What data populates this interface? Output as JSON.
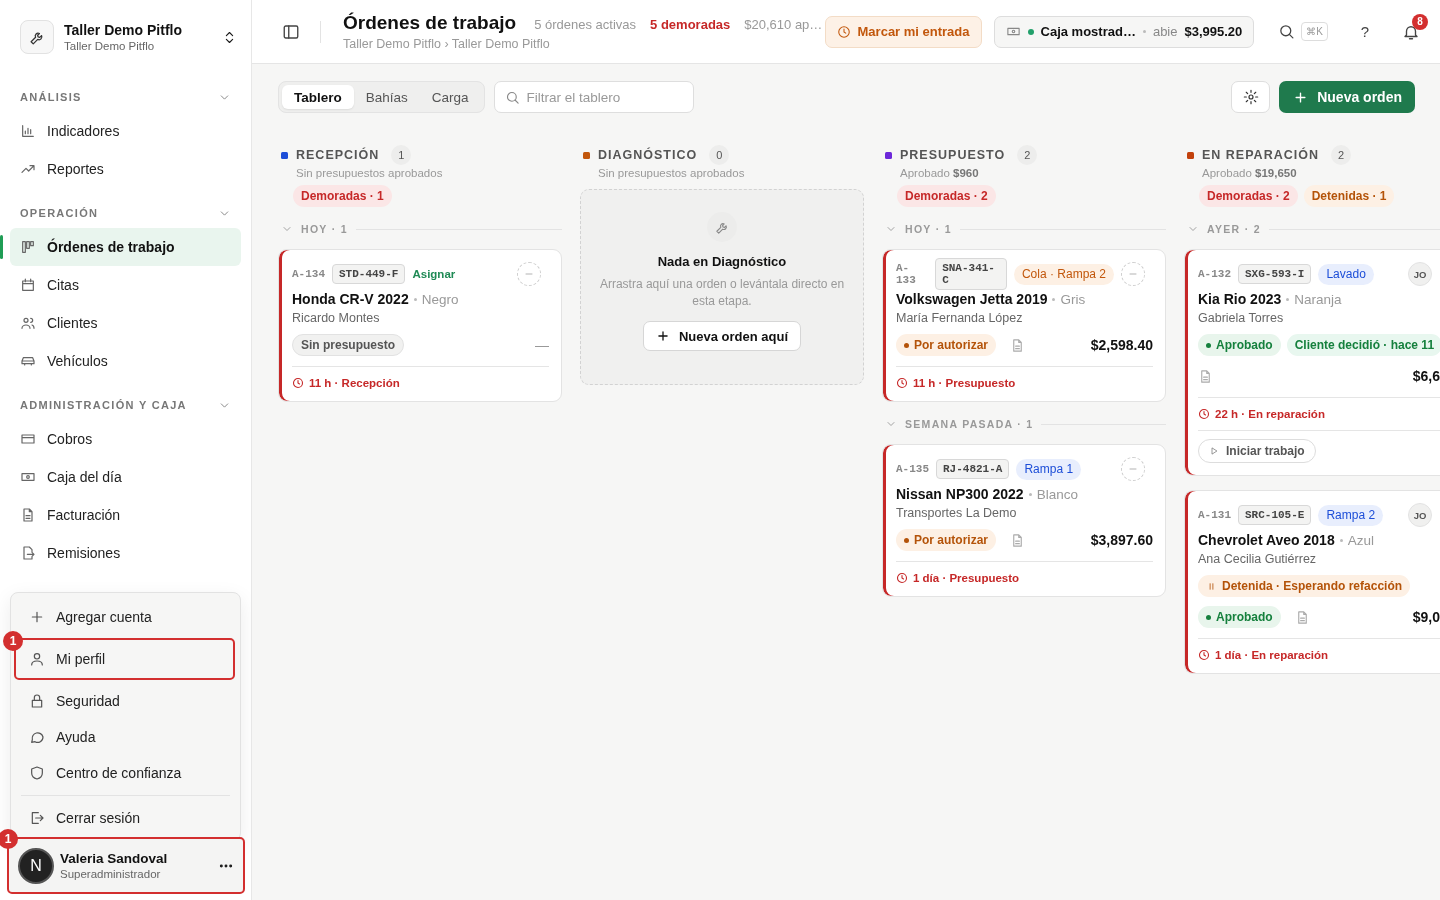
{
  "sidebar": {
    "workspace": {
      "name": "Taller Demo Pitflo",
      "subtitle": "Taller Demo Pitflo"
    },
    "sections": [
      {
        "title": "ANÁLISIS",
        "expanded": true,
        "items": [
          {
            "label": "Indicadores",
            "selected": false
          },
          {
            "label": "Reportes",
            "selected": false
          }
        ]
      },
      {
        "title": "OPERACIÓN",
        "expanded": true,
        "items": [
          {
            "label": "Órdenes de trabajo",
            "selected": true
          },
          {
            "label": "Citas",
            "selected": false
          },
          {
            "label": "Clientes",
            "selected": false
          },
          {
            "label": "Vehículos",
            "selected": false
          }
        ]
      },
      {
        "title": "ADMINISTRACIÓN Y CAJA",
        "expanded": true,
        "items": [
          {
            "label": "Cobros",
            "selected": false
          },
          {
            "label": "Caja del día",
            "selected": false
          },
          {
            "label": "Facturación",
            "selected": false
          },
          {
            "label": "Remisiones",
            "selected": false
          }
        ]
      }
    ],
    "account_menu": {
      "items": [
        {
          "label": "Agregar cuenta",
          "divider_before": false
        },
        {
          "label": "Mi perfil",
          "divider_before": false,
          "annotation": "1"
        },
        {
          "label": "Seguridad",
          "divider_before": false
        },
        {
          "label": "Ayuda",
          "divider_before": false
        },
        {
          "label": "Centro de confianza",
          "divider_before": false
        },
        {
          "label": "Cerrar sesión",
          "divider_before": true
        }
      ]
    },
    "user": {
      "initial": "N",
      "name": "Valeria Sandoval",
      "role": "Superadministrador",
      "annotation": "1"
    }
  },
  "header": {
    "title": "Órdenes de trabajo",
    "stats": [
      {
        "text": "5 órdenes activas",
        "kind": "normal"
      },
      {
        "text": "5 demoradas",
        "kind": "alert"
      },
      {
        "text": "$20,610 ap…",
        "kind": "normal"
      }
    ],
    "breadcrumb": "Taller Demo Pitflo › Taller Demo Pitflo",
    "clock_in": "Marcar mi entrada",
    "register": {
      "name": "Caja mostrad…",
      "open": true,
      "status": "abie",
      "amount": "$3,995.20"
    },
    "shortcut": "⌘K",
    "help": "?",
    "notifications": "8"
  },
  "toolbar": {
    "tabs": [
      {
        "label": "Tablero",
        "selected": true
      },
      {
        "label": "Bahías",
        "selected": false
      },
      {
        "label": "Carga",
        "selected": false
      }
    ],
    "filter": {
      "placeholder": "Filtrar el tablero"
    },
    "new_order": "Nueva orden"
  },
  "columns": [
    {
      "title": "RECEPCIÓN",
      "color": "#1d4ed8",
      "count": "1",
      "summary": "Sin presupuestos aprobados",
      "chips": [
        {
          "label": "Demoradas · 1",
          "kind": "delayed"
        }
      ],
      "groups": [
        {
          "label": "HOY · 1",
          "expanded": true,
          "cards": [
            {
              "id": "A-134",
              "plate": "STD-449-F",
              "tag": {
                "label": "Asignar",
                "kind": "assign"
              },
              "vehicle": "Honda CR-V 2022",
              "color_name": "Negro",
              "customer": "Ricardo Montes",
              "status": {
                "label": "Sin presupuesto",
                "kind": "neutral"
              },
              "document": false,
              "price": "—",
              "delayed": true,
              "timer": "11 h · Recepción"
            }
          ]
        }
      ]
    },
    {
      "title": "DIAGNÓSTICO",
      "color": "#c2570c",
      "count": "0",
      "summary": "Sin presupuestos aprobados",
      "empty": {
        "title": "Nada en Diagnóstico",
        "text": "Arrastra aquí una orden o levántala directo en esta etapa.",
        "button": "Nueva orden aquí"
      }
    },
    {
      "title": "PRESUPUESTO",
      "color": "#6d28d9",
      "count": "2",
      "summary": "Aprobado **$960**",
      "chips": [
        {
          "label": "Demoradas · 2",
          "kind": "delayed"
        }
      ],
      "groups": [
        {
          "label": "HOY · 1",
          "expanded": true,
          "cards": [
            {
              "id": "A-133",
              "plate": "SNA-341-C",
              "tag": {
                "label": "Cola · Rampa 2",
                "kind": "queue"
              },
              "vehicle": "Volkswagen Jetta 2019",
              "color_name": "Gris",
              "customer": "María Fernanda López",
              "status": {
                "label": "Por autorizar",
                "kind": "pending"
              },
              "document": true,
              "price": "$2,598.40",
              "delayed": true,
              "timer": "11 h · Presupuesto"
            }
          ]
        },
        {
          "label": "SEMANA PASADA · 1",
          "expanded": true,
          "cards": [
            {
              "id": "A-135",
              "plate": "RJ-4821-A",
              "tag": {
                "label": "Rampa 1",
                "kind": "bay"
              },
              "vehicle": "Nissan NP300 2022",
              "color_name": "Blanco",
              "customer": "Transportes La Demo",
              "status": {
                "label": "Por autorizar",
                "kind": "pending"
              },
              "document": true,
              "price": "$3,897.60",
              "delayed": true,
              "timer": "1 día · Presupuesto"
            }
          ]
        }
      ]
    },
    {
      "title": "EN REPARACIÓN",
      "color": "#c2410c",
      "count": "2",
      "summary": "Aprobado **$19,650**",
      "chips": [
        {
          "label": "Demoradas · 2",
          "kind": "delayed"
        },
        {
          "label": "Detenidas · 1",
          "kind": "held"
        }
      ],
      "groups": [
        {
          "label": "AYER · 2",
          "expanded": true,
          "cards": [
            {
              "id": "A-132",
              "plate": "SXG-593-I",
              "tag": {
                "label": "Lavado",
                "kind": "bay"
              },
              "assignee": "JO",
              "vehicle": "Kia Rio 2023",
              "color_name": "Naranja",
              "customer": "Gabriela Torres",
              "pills": [
                {
                  "label": "Aprobado",
                  "kind": "approved"
                },
                {
                  "label": "Cliente decidió · hace 11",
                  "kind": "decision"
                }
              ],
              "document": true,
              "price": "$6,6",
              "delayed": true,
              "timer": "22 h · En reparación",
              "action": "Iniciar trabajo"
            },
            {
              "id": "A-131",
              "plate": "SRC-105-E",
              "tag": {
                "label": "Rampa 2",
                "kind": "bay"
              },
              "assignee": "JO",
              "vehicle": "Chevrolet Aveo 2018",
              "color_name": "Azul",
              "customer": "Ana Cecilia Gutiérrez",
              "pills": [
                {
                  "label": "Detenida · Esperando refacción",
                  "kind": "held"
                }
              ],
              "status": {
                "label": "Aprobado",
                "kind": "approved"
              },
              "document": true,
              "price": "$9,0",
              "delayed": true,
              "timer": "1 día · En reparación"
            }
          ]
        }
      ]
    }
  ]
}
